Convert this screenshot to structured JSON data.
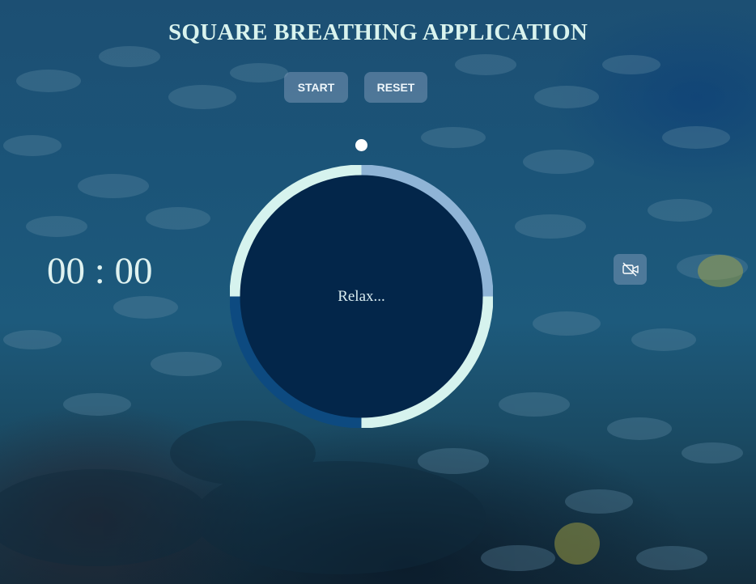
{
  "app": {
    "title": "SQUARE BREATHING APPLICATION"
  },
  "controls": {
    "start_label": "START",
    "reset_label": "RESET"
  },
  "timer": {
    "display": "00 : 00"
  },
  "breath": {
    "instruction": "Relax..."
  },
  "video_toggle": {
    "icon": "video-off-icon"
  },
  "colors": {
    "title": "#d9f3ee",
    "ring_top_right": "#8fb4d6",
    "ring_bottom_right": "#d6f3ee",
    "ring_bottom_left": "#0d4a80",
    "ring_top_left": "#d6f3ee",
    "circle_fill": "#03264a",
    "button_bg": "#7896b4"
  }
}
